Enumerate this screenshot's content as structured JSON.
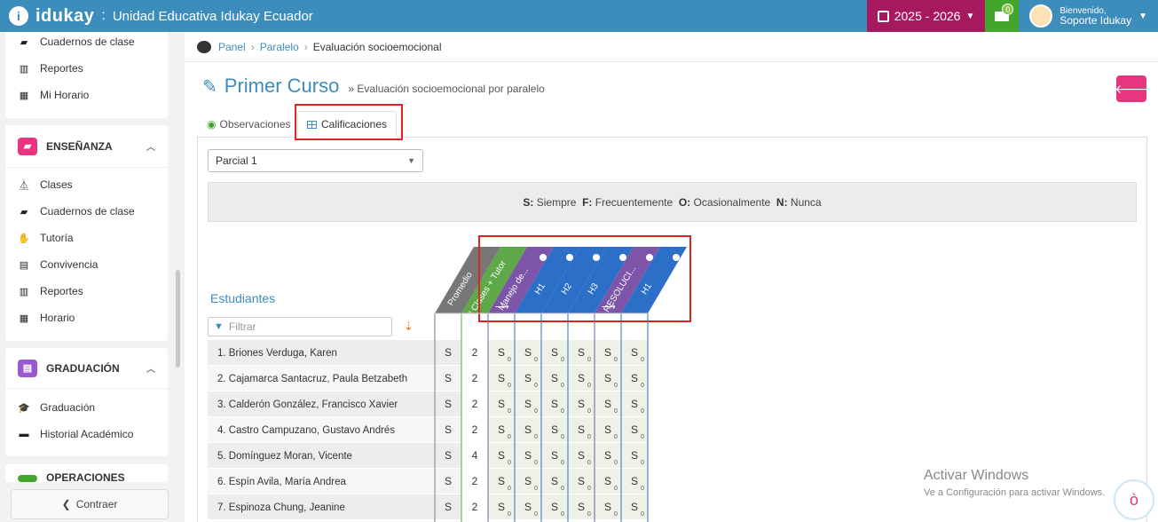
{
  "app": {
    "brand": "idukay",
    "separator": ":",
    "school": "Unidad Educativa Idukay Ecuador",
    "year": "2025 - 2026",
    "mail_count": "0",
    "welcome": "Bienvenido,",
    "user": "Soporte Idukay"
  },
  "sidebar": {
    "top_items": [
      "Cuadernos de clase",
      "Reportes",
      "Mi Horario"
    ],
    "ensenanza": {
      "title": "ENSEÑANZA",
      "items": [
        "Clases",
        "Cuadernos de clase",
        "Tutoría",
        "Convivencia",
        "Reportes",
        "Horario"
      ]
    },
    "graduacion": {
      "title": "GRADUACIÓN",
      "items": [
        "Graduación",
        "Historial Académico"
      ]
    },
    "operaciones": {
      "title": "OPERACIONES"
    },
    "collapse_label": "Contraer"
  },
  "breadcrumb": {
    "panel": "Panel",
    "paralelo": "Paralelo",
    "current": "Evaluación socioemocional"
  },
  "page": {
    "title": "Primer Curso",
    "subtitle": "» Evaluación socioemocional por paralelo",
    "tabs": {
      "observaciones": "Observaciones",
      "calificaciones": "Calificaciones"
    },
    "select_value": "Parcial 1",
    "legend": [
      {
        "key": "S:",
        "label": "Siempre"
      },
      {
        "key": "F:",
        "label": "Frecuentemente"
      },
      {
        "key": "O:",
        "label": "Ocasionalmente"
      },
      {
        "key": "N:",
        "label": "Nunca"
      }
    ],
    "students_label": "Estudiantes",
    "filter_placeholder": "Filtrar"
  },
  "gradebook": {
    "columns": [
      {
        "label": "Promedio",
        "color": "#777777",
        "arrow": false
      },
      {
        "label": "# Clases + Tutor",
        "color": "#5fa84a",
        "arrow": false
      },
      {
        "label": "Manejo de...",
        "color": "#7d55a8",
        "arrow": true
      },
      {
        "label": "H1",
        "color": "#2c6fc9",
        "arrow": false
      },
      {
        "label": "H2",
        "color": "#2c6fc9",
        "arrow": false
      },
      {
        "label": "H3",
        "color": "#2c6fc9",
        "arrow": false
      },
      {
        "label": "RESOLUCI...",
        "color": "#7d55a8",
        "arrow": true
      },
      {
        "label": "H1",
        "color": "#2c6fc9",
        "arrow": false
      }
    ],
    "grade_letter": "S",
    "grade_sub": "0",
    "students": [
      {
        "name": "1. Briones Verduga, Karen",
        "promedio": "S",
        "clases": "2"
      },
      {
        "name": "2. Cajamarca Santacruz, Paula Betzabeth",
        "promedio": "S",
        "clases": "2"
      },
      {
        "name": "3. Calderón González, Francisco Xavier",
        "promedio": "S",
        "clases": "2"
      },
      {
        "name": "4. Castro Campuzano, Gustavo Andrés",
        "promedio": "S",
        "clases": "2"
      },
      {
        "name": "5. Domínguez Moran, Vicente",
        "promedio": "S",
        "clases": "4"
      },
      {
        "name": "6. Espín Avila, María Andrea",
        "promedio": "S",
        "clases": "2"
      },
      {
        "name": "7. Espinoza Chung, Jeanine",
        "promedio": "S",
        "clases": "2"
      }
    ]
  },
  "watermark": {
    "line1": "Activar Windows",
    "line2": "Ve a Configuración para activar Windows."
  }
}
